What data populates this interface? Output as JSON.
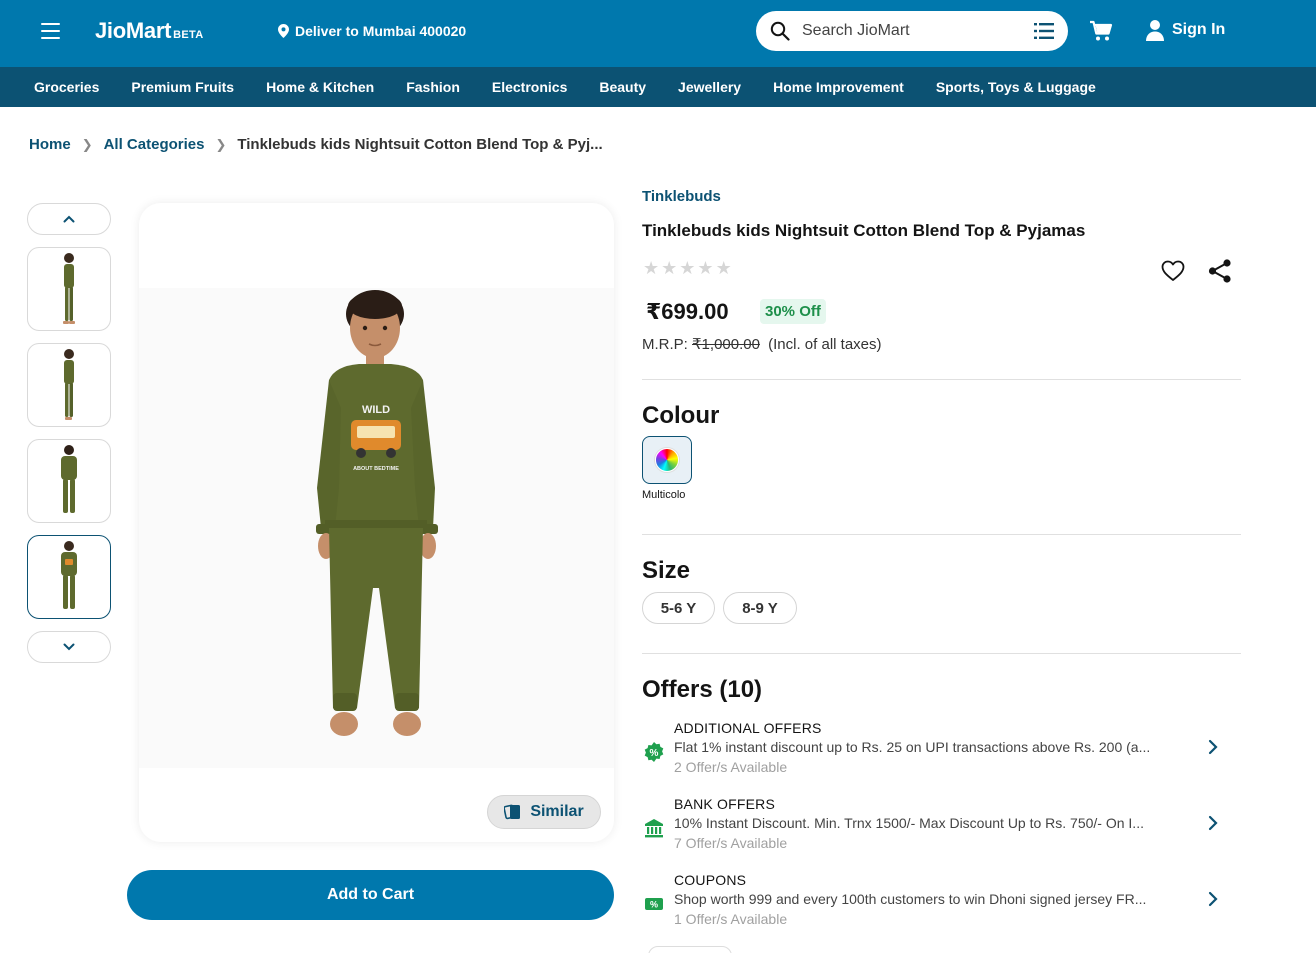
{
  "header": {
    "logo": "JioMart",
    "logo_badge": "BETA",
    "deliver_to": "Deliver to Mumbai 400020",
    "search_placeholder": "Search JioMart",
    "sign_in": "Sign In"
  },
  "categories": [
    "Groceries",
    "Premium Fruits",
    "Home & Kitchen",
    "Fashion",
    "Electronics",
    "Beauty",
    "Jewellery",
    "Home Improvement",
    "Sports, Toys & Luggage"
  ],
  "breadcrumb": {
    "home": "Home",
    "all_categories": "All Categories",
    "current": "Tinklebuds kids Nightsuit Cotton Blend Top & Pyj..."
  },
  "gallery": {
    "thumbnail_count": 4,
    "active_thumbnail": 4,
    "similar_label": "Similar",
    "print_text": [
      "WILD",
      "ABOUT BEDTIME"
    ]
  },
  "actions": {
    "add_to_cart": "Add to Cart"
  },
  "product": {
    "brand": "Tinklebuds",
    "title": "Tinklebuds kids Nightsuit Cotton Blend Top & Pyjamas",
    "rating_stars": 5,
    "price": "₹699.00",
    "discount": "30% Off",
    "mrp_label": "M.R.P:",
    "mrp_value": "₹1,000.00",
    "tax_note": "(Incl. of all taxes)"
  },
  "colour": {
    "heading": "Colour",
    "selected": "Multicolo"
  },
  "size": {
    "heading": "Size",
    "options": [
      "5-6 Y",
      "8-9 Y"
    ]
  },
  "offers": {
    "heading": "Offers (10)",
    "items": [
      {
        "title": "ADDITIONAL OFFERS",
        "desc": "Flat 1% instant discount up to Rs. 25 on UPI transactions above Rs. 200 (a...",
        "count": "2 Offer/s Available",
        "icon": "percent-badge-icon"
      },
      {
        "title": "BANK OFFERS",
        "desc": "10% Instant Discount. Min. Trnx 1500/- Max Discount Up to Rs. 750/- On I...",
        "count": "7 Offer/s Available",
        "icon": "bank-icon"
      },
      {
        "title": "COUPONS",
        "desc": "Shop worth 999 and every 100th customers to win Dhoni signed jersey FR...",
        "count": "1 Offer/s Available",
        "icon": "coupon-icon"
      }
    ]
  },
  "colors": {
    "primary": "#0078ad",
    "nav_dark": "#0c5273",
    "discount_bg": "#e5f7ee",
    "discount_text": "#1d8f4a",
    "offer_green": "#1fa04e"
  }
}
